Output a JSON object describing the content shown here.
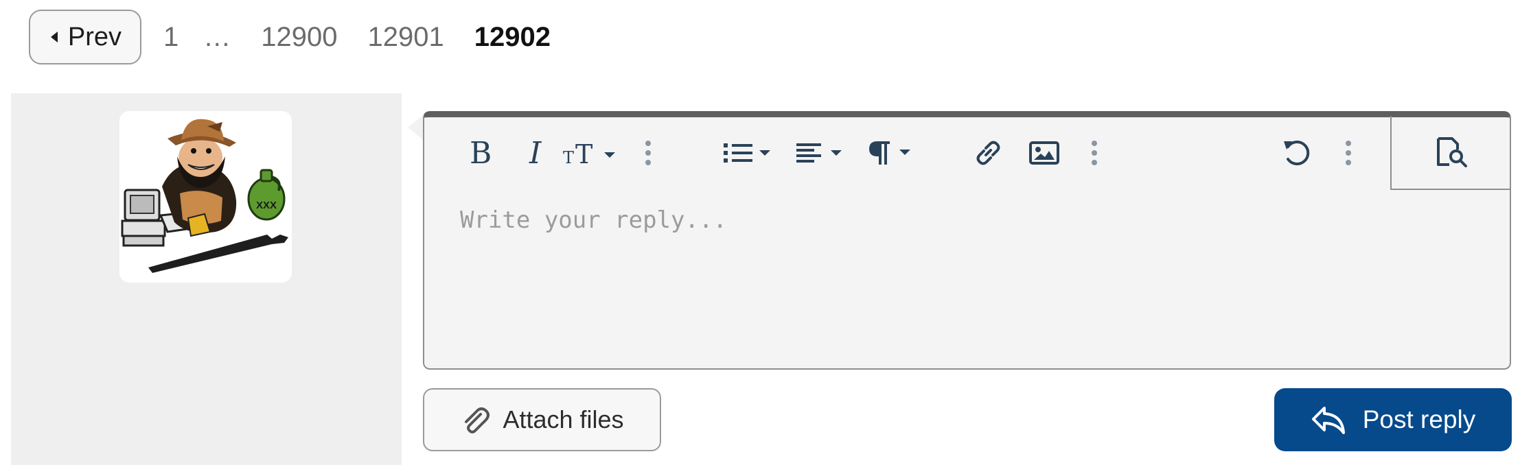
{
  "pagination": {
    "prev_label": "Prev",
    "pages": [
      "1",
      "12900",
      "12901"
    ],
    "ellipsis": "…",
    "current": "12902"
  },
  "avatar": {
    "jug_label": "XXX"
  },
  "editor": {
    "placeholder": "Write your reply...",
    "value": "",
    "toolbar_icons": [
      "bold-icon",
      "italic-icon",
      "font-size-icon",
      "more-text-icon",
      "list-icon",
      "align-icon",
      "paragraph-icon",
      "link-icon",
      "image-icon",
      "more-insert-icon",
      "undo-icon",
      "more-options-icon",
      "preview-icon"
    ]
  },
  "actions": {
    "attach_label": "Attach files",
    "post_label": "Post reply"
  },
  "colors": {
    "accent": "#064a8c",
    "toolbar_icon": "#2a4259",
    "editor_bg": "#f4f4f4",
    "sidebar_bg": "#efefef"
  }
}
